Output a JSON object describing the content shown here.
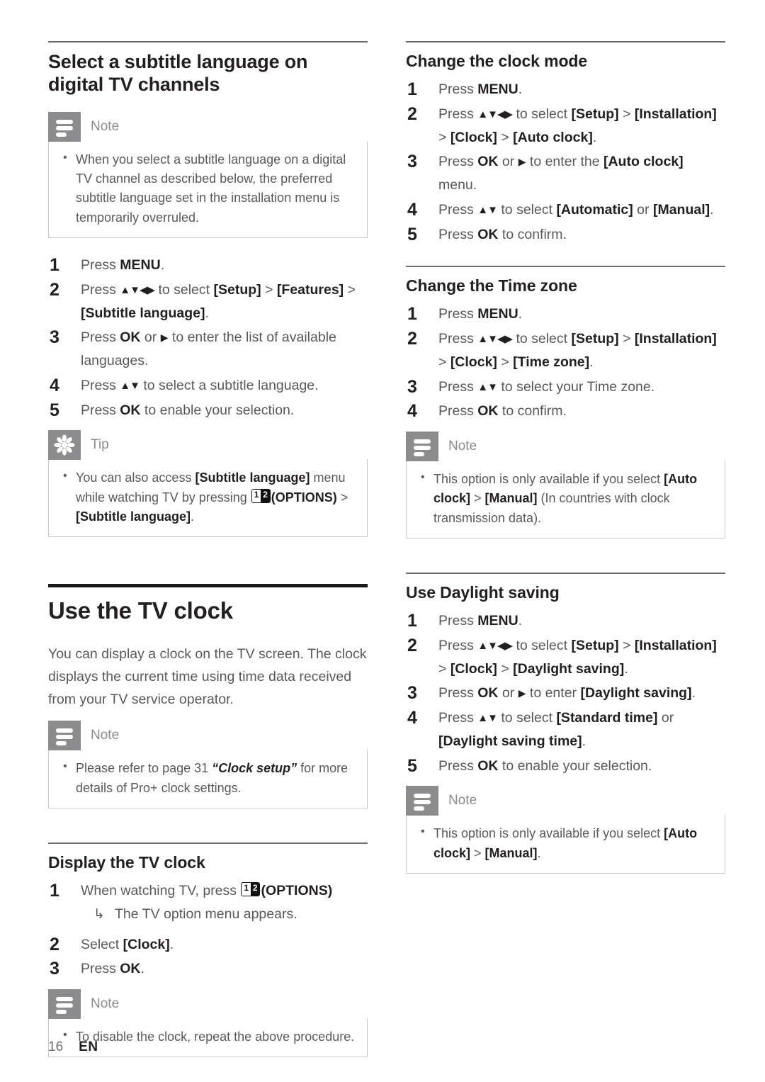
{
  "document": {
    "page_number": "16",
    "language_code": "EN"
  },
  "left_column": {
    "section_subtitle": {
      "heading": "Select a subtitle language on digital TV channels",
      "note": {
        "label": "Note",
        "icon": "note-icon",
        "items": [
          "When you select a subtitle language on a digital TV channel as described below, the preferred subtitle language set in the installation menu is temporarily overruled."
        ]
      },
      "steps": [
        {
          "num": "1",
          "text": "Press MENU."
        },
        {
          "num": "2",
          "text": "Press ▲▼◀▶ to select [Setup] > [Features] > [Subtitle language]."
        },
        {
          "num": "3",
          "text": "Press OK or ▶ to enter the list of available languages."
        },
        {
          "num": "4",
          "text": "Press ▲▼ to select a subtitle language."
        },
        {
          "num": "5",
          "text": "Press OK to enable your selection."
        }
      ],
      "tip": {
        "label": "Tip",
        "icon": "tip-icon",
        "items": [
          "You can also access [Subtitle language] menu while watching TV by pressing 12 (OPTIONS) > [Subtitle language]."
        ]
      }
    },
    "chapter": {
      "title": "Use the TV clock",
      "intro": "You can display a clock on the TV screen. The clock displays the current time using time data received from your TV service operator.",
      "note": {
        "label": "Note",
        "icon": "note-icon",
        "items": [
          "Please refer to page 31 “Clock setup” for more details of Pro+ clock settings."
        ]
      }
    },
    "section_display_clock": {
      "heading": "Display the TV clock",
      "steps": [
        {
          "num": "1",
          "text": "When watching TV, press 12 (OPTIONS)",
          "sub": "The TV option menu appears."
        },
        {
          "num": "2",
          "text": "Select [Clock]."
        },
        {
          "num": "3",
          "text": "Press OK."
        }
      ],
      "note": {
        "label": "Note",
        "icon": "note-icon",
        "items": [
          "To disable the clock, repeat the above procedure."
        ]
      }
    }
  },
  "right_column": {
    "section_clock_mode": {
      "heading": "Change the clock mode",
      "steps": [
        {
          "num": "1",
          "text": "Press MENU."
        },
        {
          "num": "2",
          "text": "Press ▲▼◀▶ to select [Setup] > [Installation] > [Clock] > [Auto clock]."
        },
        {
          "num": "3",
          "text": "Press OK or ▶ to enter the [Auto clock] menu."
        },
        {
          "num": "4",
          "text": "Press ▲▼ to select [Automatic] or [Manual]."
        },
        {
          "num": "5",
          "text": "Press OK to confirm."
        }
      ]
    },
    "section_time_zone": {
      "heading": "Change the Time zone",
      "steps": [
        {
          "num": "1",
          "text": "Press MENU."
        },
        {
          "num": "2",
          "text": "Press ▲▼◀▶ to select [Setup] > [Installation] > [Clock] > [Time zone]."
        },
        {
          "num": "3",
          "text": "Press ▲▼ to select your Time zone."
        },
        {
          "num": "4",
          "text": "Press OK to confirm."
        }
      ],
      "note": {
        "label": "Note",
        "icon": "note-icon",
        "items": [
          "This option is only available if you select [Auto clock] > [Manual] (In countries with clock transmission data)."
        ]
      }
    },
    "section_daylight_saving": {
      "heading": "Use Daylight saving",
      "steps": [
        {
          "num": "1",
          "text": "Press MENU."
        },
        {
          "num": "2",
          "text": "Press ▲▼◀▶ to select [Setup] > [Installation] > [Clock] > [Daylight saving]."
        },
        {
          "num": "3",
          "text": "Press OK or ▶ to enter [Daylight saving]."
        },
        {
          "num": "4",
          "text": "Press ▲▼ to select [Standard time] or [Daylight saving time]."
        },
        {
          "num": "5",
          "text": "Press OK to enable your selection."
        }
      ],
      "note": {
        "label": "Note",
        "icon": "note-icon",
        "items": [
          "This option is only available if you select [Auto clock] > [Manual]."
        ]
      }
    }
  },
  "glyphs": {
    "options_key_left": "1",
    "options_key_right": "2",
    "options_label": "(OPTIONS)",
    "sub_arrow": "↳"
  }
}
